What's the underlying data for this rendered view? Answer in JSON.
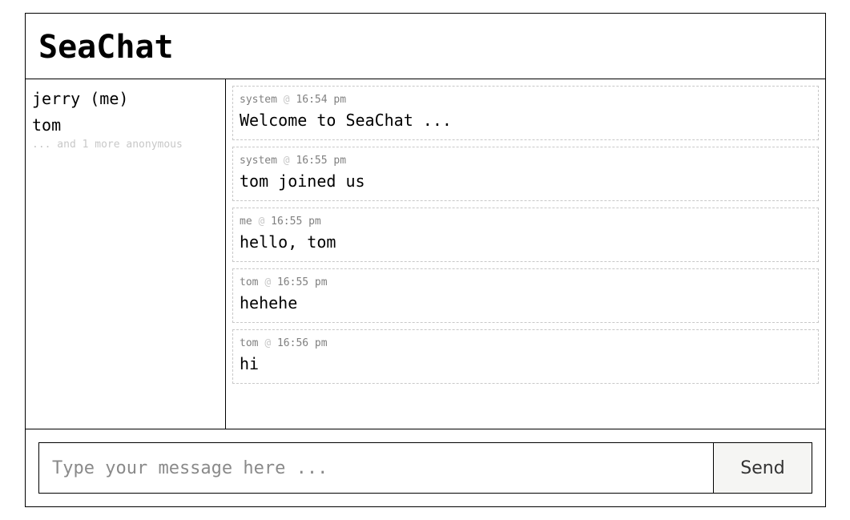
{
  "header": {
    "title": "SeaChat"
  },
  "sidebar": {
    "users": [
      "jerry (me)",
      "tom"
    ],
    "more_label": "... and 1 more anonymous"
  },
  "messages": [
    {
      "sender": "system",
      "at": "@",
      "time": "16:54 pm",
      "text": "Welcome to SeaChat ..."
    },
    {
      "sender": "system",
      "at": "@",
      "time": "16:55 pm",
      "text": "tom joined us"
    },
    {
      "sender": "me",
      "at": "@",
      "time": "16:55 pm",
      "text": "hello, tom"
    },
    {
      "sender": "tom",
      "at": "@",
      "time": "16:55 pm",
      "text": "hehehe"
    },
    {
      "sender": "tom",
      "at": "@",
      "time": "16:56 pm",
      "text": "hi"
    }
  ],
  "composer": {
    "value": "",
    "placeholder": "Type your message here ...",
    "send_label": "Send"
  },
  "colors": {
    "border": "#000000",
    "dashed_border": "#c8c8c8",
    "meta_text": "#808080",
    "muted_text": "#c8c8c8",
    "send_bg": "#f5f5f3"
  }
}
